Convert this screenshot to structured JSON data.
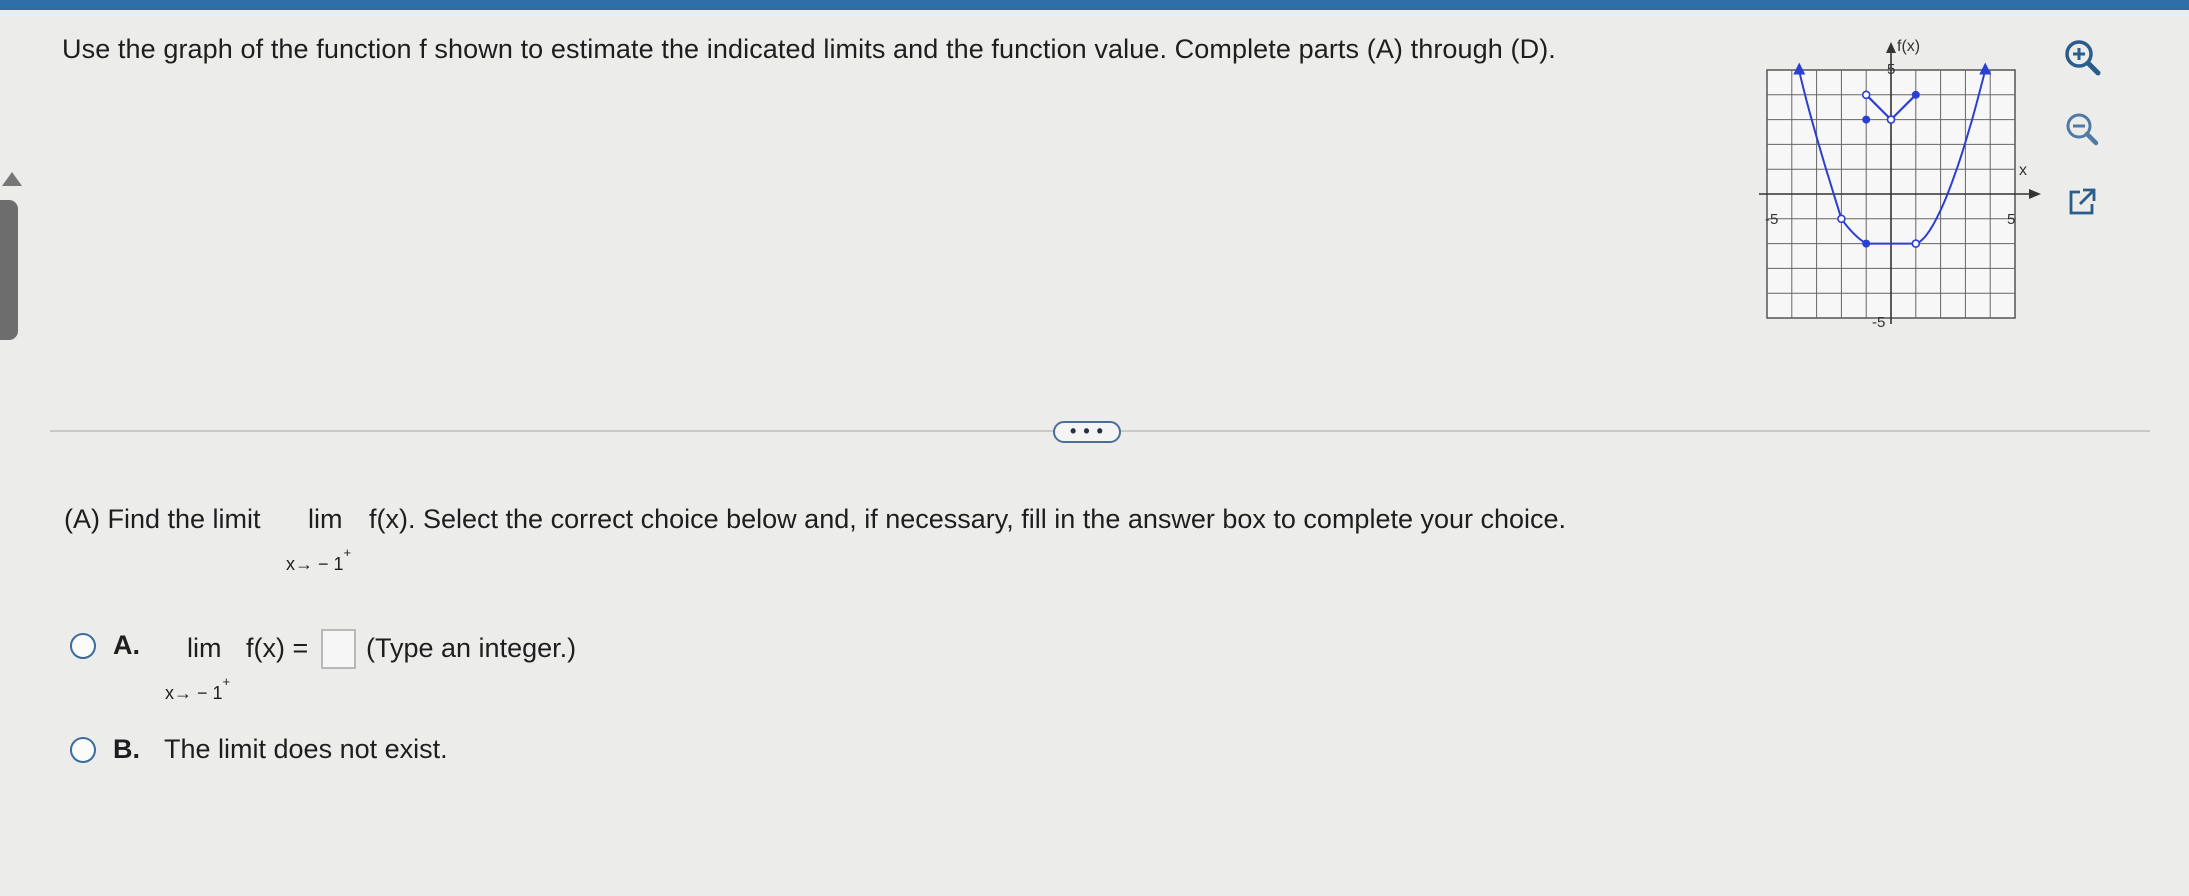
{
  "question": "Use the graph of the function f shown to estimate the indicated limits and the function value. Complete parts (A) through (D).",
  "graph": {
    "y_axis_label": "f(x)",
    "x_axis_label": "x",
    "tick_labels": {
      "x_neg": "-5",
      "x_pos": "5",
      "y_pos": "5",
      "y_neg": "-5"
    },
    "xlim": [
      -5,
      5
    ],
    "ylim": [
      -5,
      5
    ],
    "curve_color": "#2b3fd0"
  },
  "toolbar": {
    "zoom_in_icon": "zoom-in-icon",
    "zoom_out_icon": "zoom-out-icon",
    "popout_icon": "popout-icon"
  },
  "more_button": "• • •",
  "partA": {
    "prefix": "(A) Find the limit",
    "lim": "lim",
    "sub": "x→ − 1",
    "sup": "+",
    "func": "f(x). Select the correct choice below and, if necessary, fill in the answer box to complete your choice."
  },
  "choices": [
    {
      "letter": "A.",
      "lim": "lim",
      "sub": "x→ − 1",
      "sup": "+",
      "expr": "f(x) =",
      "hint": "(Type an integer.)",
      "answer_value": ""
    },
    {
      "letter": "B.",
      "text": "The limit does not exist."
    }
  ],
  "colors": {
    "accent": "#2f6fa8",
    "radio": "#3a6c9e",
    "curve": "#2b3fd0"
  }
}
